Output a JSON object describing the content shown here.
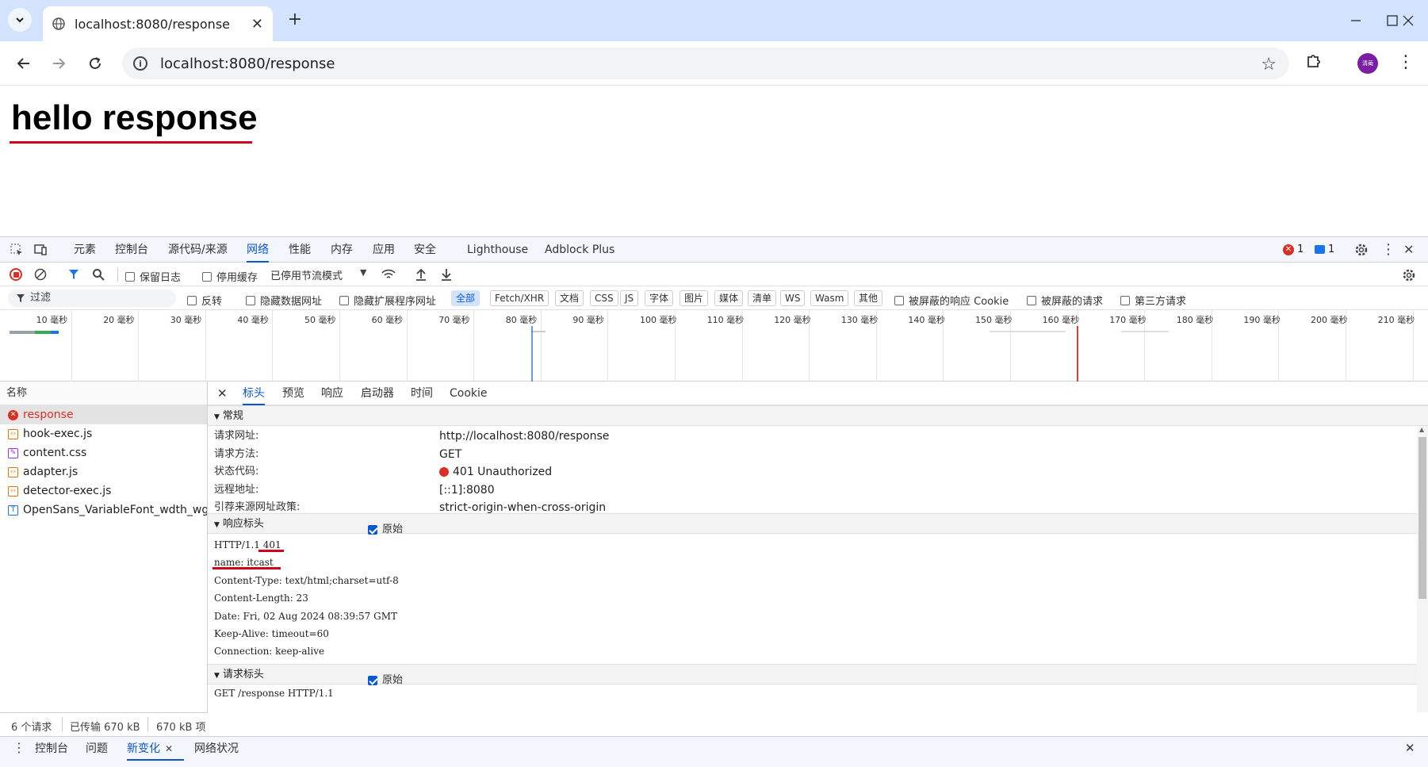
{
  "browser": {
    "tab_title": "localhost:8080/response",
    "url": "localhost:8080/response",
    "avatar_text": "清蔺"
  },
  "page": {
    "heading": "hello response"
  },
  "devtools": {
    "tabs": [
      "元素",
      "控制台",
      "源代码/来源",
      "网络",
      "性能",
      "内存",
      "应用",
      "安全",
      "Lighthouse",
      "Adblock Plus"
    ],
    "active_tab": "网络",
    "error_count": "1",
    "message_count": "1",
    "net_toolbar": {
      "preserve_log": "保留日志",
      "disable_cache": "停用缓存",
      "throttle": "已停用节流模式"
    },
    "filter": {
      "placeholder": "过滤",
      "invert": "反转",
      "hide_data_urls": "隐藏数据网址",
      "hide_ext_urls": "隐藏扩展程序网址",
      "types": [
        "全部",
        "Fetch/XHR",
        "文档",
        "CSS",
        "JS",
        "字体",
        "图片",
        "媒体",
        "清单",
        "WS",
        "Wasm",
        "其他"
      ],
      "blocked_cookies": "被屏蔽的响应 Cookie",
      "blocked_requests": "被屏蔽的请求",
      "third_party": "第三方请求"
    },
    "timeline_ticks": [
      "10 毫秒",
      "20 毫秒",
      "30 毫秒",
      "40 毫秒",
      "50 毫秒",
      "60 毫秒",
      "70 毫秒",
      "80 毫秒",
      "90 毫秒",
      "100 毫秒",
      "110 毫秒",
      "120 毫秒",
      "130 毫秒",
      "140 毫秒",
      "150 毫秒",
      "160 毫秒",
      "170 毫秒",
      "180 毫秒",
      "190 毫秒",
      "200 毫秒",
      "210 毫秒"
    ],
    "name_header": "名称",
    "requests": [
      {
        "name": "response",
        "type": "error",
        "color": "#d93025"
      },
      {
        "name": "hook-exec.js",
        "type": "script",
        "color": "#e37400"
      },
      {
        "name": "content.css",
        "type": "style",
        "color": "#9334e6"
      },
      {
        "name": "adapter.js",
        "type": "script",
        "color": "#e37400"
      },
      {
        "name": "detector-exec.js",
        "type": "script",
        "color": "#e37400"
      },
      {
        "name": "OpenSans_VariableFont_wdth_wg...",
        "type": "font",
        "color": "#1a73e8"
      }
    ],
    "detail_tabs": [
      "标头",
      "预览",
      "响应",
      "启动器",
      "时间",
      "Cookie"
    ],
    "general": {
      "title": "常规",
      "rows": [
        {
          "k": "请求网址:",
          "v": "http://localhost:8080/response"
        },
        {
          "k": "请求方法:",
          "v": "GET"
        },
        {
          "k": "状态代码:",
          "v": "401 Unauthorized"
        },
        {
          "k": "远程地址:",
          "v": "[::1]:8080"
        },
        {
          "k": "引荐来源网址政策:",
          "v": "strict-origin-when-cross-origin"
        }
      ]
    },
    "response_headers": {
      "title": "响应标头",
      "raw_label": "原始",
      "lines": [
        "HTTP/1.1 401",
        "name: itcast",
        "Content-Type: text/html;charset=utf-8",
        "Content-Length: 23",
        "Date: Fri, 02 Aug 2024 08:39:57 GMT",
        "Keep-Alive: timeout=60",
        "Connection: keep-alive"
      ]
    },
    "request_headers": {
      "title": "请求标头",
      "raw_label": "原始",
      "lines": [
        "GET /response HTTP/1.1"
      ]
    },
    "status": {
      "requests": "6 个请求",
      "transferred": "已传输 670 kB",
      "resources": "670 kB 项"
    },
    "drawer_tabs": [
      "控制台",
      "问题",
      "新变化",
      "网络状况"
    ],
    "drawer_active": "新变化"
  },
  "colors": {
    "accent": "#0b57d0",
    "error": "#d93025",
    "annotation": "#d0021b"
  }
}
